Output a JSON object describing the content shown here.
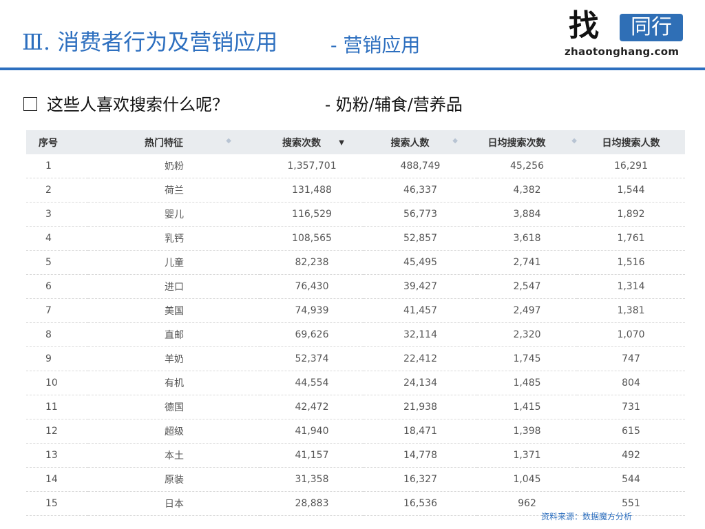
{
  "header": {
    "title": "Ⅲ. 消费者行为及营销应用",
    "subtitle": "- 营销应用",
    "logo": {
      "char": "找",
      "box_text": "同行",
      "domain": "zhaotonghang.com"
    }
  },
  "content": {
    "question": "这些人喜欢搜索什么呢？",
    "category": "- 奶粉/辅食/营养品"
  },
  "table": {
    "columns": [
      "序号",
      "热门特征",
      "搜索次数",
      "搜索人数",
      "日均搜索次数",
      "日均搜索人数"
    ],
    "sort_icons": {
      "feature": "sort-icon",
      "search_count": "sort-desc-icon",
      "search_people": "sort-icon",
      "daily_count": "sort-icon"
    },
    "rows": [
      [
        "1",
        "奶粉",
        "1,357,701",
        "488,749",
        "45,256",
        "16,291"
      ],
      [
        "2",
        "荷兰",
        "131,488",
        "46,337",
        "4,382",
        "1,544"
      ],
      [
        "3",
        "婴儿",
        "116,529",
        "56,773",
        "3,884",
        "1,892"
      ],
      [
        "4",
        "乳钙",
        "108,565",
        "52,857",
        "3,618",
        "1,761"
      ],
      [
        "5",
        "儿童",
        "82,238",
        "45,495",
        "2,741",
        "1,516"
      ],
      [
        "6",
        "进口",
        "76,430",
        "39,427",
        "2,547",
        "1,314"
      ],
      [
        "7",
        "美国",
        "74,939",
        "41,457",
        "2,497",
        "1,381"
      ],
      [
        "8",
        "直邮",
        "69,626",
        "32,114",
        "2,320",
        "1,070"
      ],
      [
        "9",
        "羊奶",
        "52,374",
        "22,412",
        "1,745",
        "747"
      ],
      [
        "10",
        "有机",
        "44,554",
        "24,134",
        "1,485",
        "804"
      ],
      [
        "11",
        "德国",
        "42,472",
        "21,938",
        "1,415",
        "731"
      ],
      [
        "12",
        "超级",
        "41,940",
        "18,471",
        "1,398",
        "615"
      ],
      [
        "13",
        "本土",
        "41,157",
        "14,778",
        "1,371",
        "492"
      ],
      [
        "14",
        "原装",
        "31,358",
        "16,327",
        "1,045",
        "544"
      ],
      [
        "15",
        "日本",
        "28,883",
        "16,536",
        "962",
        "551"
      ]
    ]
  },
  "footer": {
    "source": "资料来源：数据魔方分析"
  },
  "colors": {
    "accent": "#2d6fbf",
    "header_bg": "#e9ecef",
    "logo_box": "#2f6fb6"
  }
}
